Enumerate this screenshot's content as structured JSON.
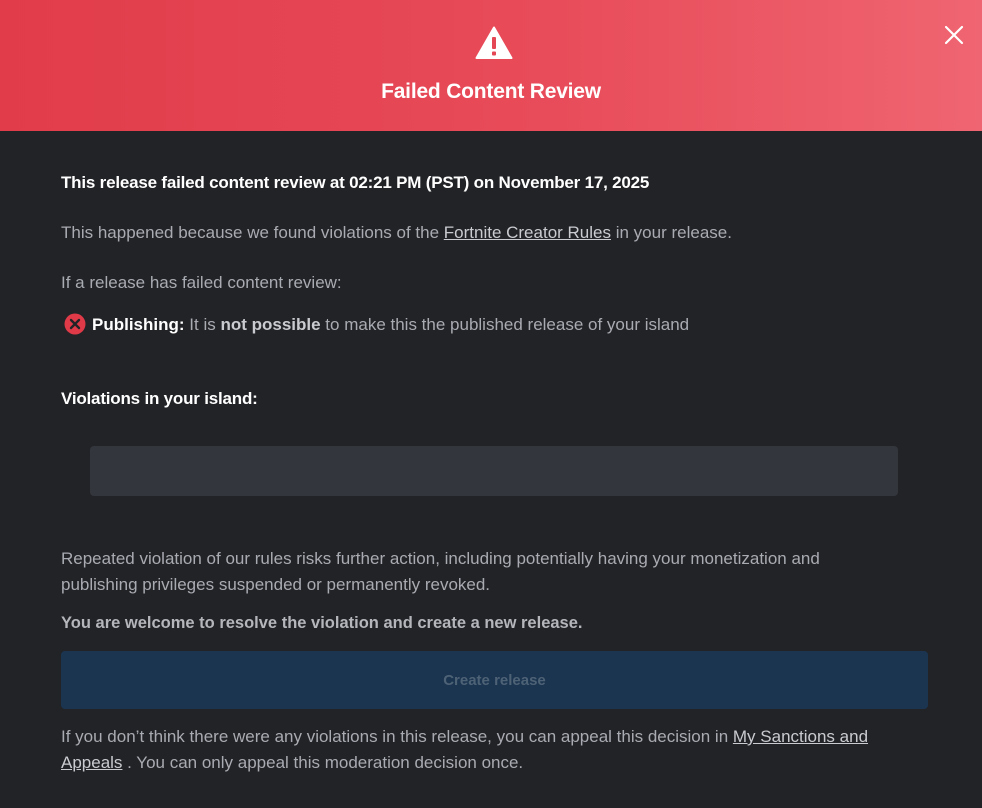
{
  "header": {
    "title": "Failed Content Review",
    "icon": "warning-triangle-icon",
    "close_icon": "close-icon",
    "accent_from": "#e13c4a",
    "accent_to": "#ef6571"
  },
  "body": {
    "headline": "This release failed content review at 02:21 PM (PST) on November 17, 2025",
    "reason_prefix": "This happened because we found violations of the ",
    "reason_link": "Fortnite Creator Rules",
    "reason_suffix": " in your release.",
    "if_failed": "If a release has failed content review:",
    "publishing": {
      "icon": "error-x-circle-icon",
      "label": "Publishing:",
      "text_before": " It is ",
      "emphasis": "not possible",
      "text_after": " to make this the published release of your island"
    },
    "violations_title": "Violations in your island:",
    "warning_paragraph": "Repeated violation of our rules risks further action, including potentially having your monetization and publishing privileges suspended or permanently revoked.",
    "welcome": "You are welcome to resolve the violation and create a new release.",
    "create_button": "Create release",
    "appeal_prefix": "If you don’t think there were any violations in this release, you can appeal this decision in ",
    "appeal_link": "My Sanctions and Appeals",
    "appeal_suffix": " . You can only appeal this moderation decision once."
  }
}
